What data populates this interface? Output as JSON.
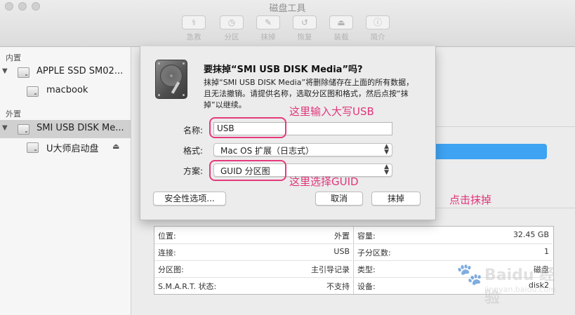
{
  "window": {
    "title": "磁盘工具"
  },
  "toolbar": {
    "items": [
      {
        "label": "急救",
        "icon": "stethoscope-icon",
        "glyph": "⚕"
      },
      {
        "label": "分区",
        "icon": "partition-icon",
        "glyph": "◷"
      },
      {
        "label": "抹掉",
        "icon": "erase-icon",
        "glyph": "✎"
      },
      {
        "label": "恢复",
        "icon": "restore-icon",
        "glyph": "↺"
      },
      {
        "label": "装载",
        "icon": "mount-icon",
        "glyph": "⏏"
      },
      {
        "label": "简介",
        "icon": "info-icon",
        "glyph": "ⓘ"
      }
    ]
  },
  "sidebar": {
    "internal_header": "内置",
    "internal_disk": "APPLE SSD SM02...",
    "internal_volume": "macbook",
    "external_header": "外置",
    "external_disk": "SMI USB DISK Me...",
    "external_volume": "U大师启动盘",
    "disclosure_glyph": "▼",
    "eject_glyph": "⏏"
  },
  "dialog": {
    "question": "要抹掉“SMI USB DISK Media”吗?",
    "description": "抹掉“SMI USB DISK Media”将删除储存在上面的所有数据，且无法撤销。请提供名称，选取分区图和格式，然后点按“抹掉”以继续。",
    "name_label": "名称:",
    "name_value": "USB",
    "format_label": "格式:",
    "format_value": "Mac OS 扩展（日志式）",
    "scheme_label": "方案:",
    "scheme_value": "GUID 分区图",
    "security_button": "安全性选项...",
    "cancel_button": "取消",
    "erase_button": "抹掉",
    "chevron_glyph": "⌃⌄"
  },
  "annotations": {
    "name_hint": "这里输入大写USB",
    "scheme_hint": "这里选择GUID",
    "erase_hint": "点击抹掉",
    "color": "#e53a7c"
  },
  "info": {
    "rows": [
      {
        "left_key": "位置:",
        "left_value": "外置",
        "right_key": "容量:",
        "right_value": "32.45 GB"
      },
      {
        "left_key": "连接:",
        "left_value": "USB",
        "right_key": "子分区数:",
        "right_value": "1"
      },
      {
        "left_key": "分区图:",
        "left_value": "主引导记录",
        "right_key": "类型:",
        "right_value": "磁盘"
      },
      {
        "left_key": "S.M.A.R.T. 状态:",
        "left_value": "不支持",
        "right_key": "设备:",
        "right_value": "disk2"
      }
    ]
  },
  "watermark": {
    "text": "Baidu 经验",
    "url": "jingyan.baidu.com"
  },
  "colors": {
    "accent_blue": "#3ea3f2",
    "annotation_pink": "#e53a7c"
  }
}
